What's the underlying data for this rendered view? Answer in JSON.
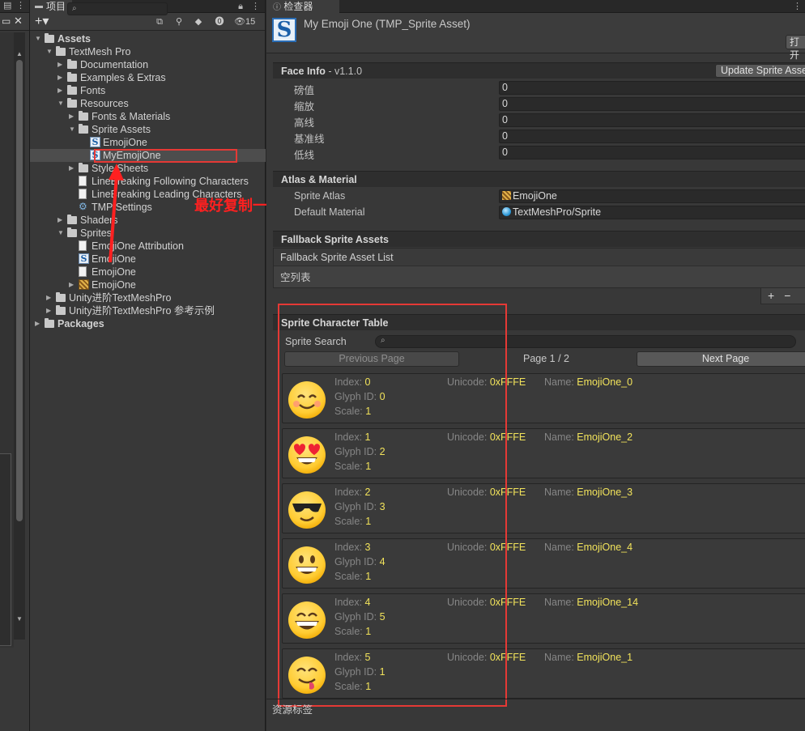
{
  "project_panel": {
    "tab_label": "项目",
    "search_placeholder": "",
    "visible_count": "15",
    "tree": [
      {
        "label": "Assets",
        "depth": 0,
        "kind": "folder",
        "expanded": true,
        "bold": true
      },
      {
        "label": "TextMesh Pro",
        "depth": 1,
        "kind": "folder",
        "expanded": true
      },
      {
        "label": "Documentation",
        "depth": 2,
        "kind": "folder",
        "expanded": false
      },
      {
        "label": "Examples & Extras",
        "depth": 2,
        "kind": "folder",
        "expanded": false
      },
      {
        "label": "Fonts",
        "depth": 2,
        "kind": "folder",
        "expanded": false
      },
      {
        "label": "Resources",
        "depth": 2,
        "kind": "folder",
        "expanded": true
      },
      {
        "label": "Fonts & Materials",
        "depth": 3,
        "kind": "folder",
        "expanded": false
      },
      {
        "label": "Sprite Assets",
        "depth": 3,
        "kind": "folder",
        "expanded": true
      },
      {
        "label": "EmojiOne",
        "depth": 4,
        "kind": "sprite-asset"
      },
      {
        "label": "MyEmojiOne",
        "depth": 4,
        "kind": "sprite-asset",
        "selected": true
      },
      {
        "label": "Style Sheets",
        "depth": 3,
        "kind": "folder",
        "expanded": false
      },
      {
        "label": "LineBreaking Following Characters",
        "depth": 3,
        "kind": "text"
      },
      {
        "label": "LineBreaking Leading Characters",
        "depth": 3,
        "kind": "text"
      },
      {
        "label": "TMP Settings",
        "depth": 3,
        "kind": "settings"
      },
      {
        "label": "Shaders",
        "depth": 2,
        "kind": "folder",
        "expanded": false
      },
      {
        "label": "Sprites",
        "depth": 2,
        "kind": "folder",
        "expanded": true
      },
      {
        "label": "EmojiOne Attribution",
        "depth": 3,
        "kind": "text"
      },
      {
        "label": "EmojiOne",
        "depth": 3,
        "kind": "sprite-asset"
      },
      {
        "label": "EmojiOne",
        "depth": 3,
        "kind": "text"
      },
      {
        "label": "EmojiOne",
        "depth": 3,
        "kind": "atlas",
        "expandable": true
      },
      {
        "label": "Unity进阶TextMeshPro",
        "depth": 1,
        "kind": "folder",
        "expanded": false
      },
      {
        "label": "Unity进阶TextMeshPro 参考示例",
        "depth": 1,
        "kind": "folder",
        "expanded": false
      },
      {
        "label": "Packages",
        "depth": 0,
        "kind": "folder",
        "expanded": false,
        "bold": true
      }
    ]
  },
  "annotation": {
    "text": "最好复制一份到Resource并改名",
    "color": "#ff2020"
  },
  "inspector": {
    "tab_label": "检查器",
    "asset_title": "My Emoji One (TMP_Sprite Asset)",
    "open_button": "打开",
    "face_info": {
      "title": "Face Info",
      "version": " - v1.1.0",
      "update_button": "Update Sprite Asset",
      "fields": [
        {
          "label": "磅值",
          "value": "0"
        },
        {
          "label": "缩放",
          "value": "0"
        },
        {
          "label": "高线",
          "value": "0"
        },
        {
          "label": "基准线",
          "value": "0"
        },
        {
          "label": "低线",
          "value": "0"
        }
      ]
    },
    "atlas_material": {
      "title": "Atlas & Material",
      "sprite_atlas_label": "Sprite Atlas",
      "sprite_atlas_value": "EmojiOne",
      "default_material_label": "Default Material",
      "default_material_value": "TextMeshPro/Sprite"
    },
    "fallback": {
      "title": "Fallback Sprite Assets",
      "list_header": "Fallback Sprite Asset List",
      "empty_text": "空列表",
      "add": "+",
      "remove": "−"
    },
    "sprite_table": {
      "title": "Sprite Character Table",
      "search_label": "Sprite Search",
      "prev_button": "Previous Page",
      "page_label": "Page 1 / 2",
      "next_button": "Next Page",
      "labels": {
        "index": "Index: ",
        "unicode": "Unicode: ",
        "name": "Name: ",
        "glyph": "Glyph ID: ",
        "scale": "Scale: "
      },
      "rows": [
        {
          "index": "0",
          "unicode": "0xFFFE",
          "name": "EmojiOne_0",
          "glyph_id": "0",
          "scale": "1",
          "emoji": "smile-blush"
        },
        {
          "index": "1",
          "unicode": "0xFFFE",
          "name": "EmojiOne_2",
          "glyph_id": "2",
          "scale": "1",
          "emoji": "heart-eyes"
        },
        {
          "index": "2",
          "unicode": "0xFFFE",
          "name": "EmojiOne_3",
          "glyph_id": "3",
          "scale": "1",
          "emoji": "sunglasses"
        },
        {
          "index": "3",
          "unicode": "0xFFFE",
          "name": "EmojiOne_4",
          "glyph_id": "4",
          "scale": "1",
          "emoji": "grin"
        },
        {
          "index": "4",
          "unicode": "0xFFFE",
          "name": "EmojiOne_14",
          "glyph_id": "5",
          "scale": "1",
          "emoji": "big-grin"
        },
        {
          "index": "5",
          "unicode": "0xFFFE",
          "name": "EmojiOne_1",
          "glyph_id": "1",
          "scale": "1",
          "emoji": "yum"
        }
      ]
    },
    "footer_label": "资源标签"
  },
  "colors": {
    "value_yellow": "#f2e35b",
    "highlight_red": "#e53935",
    "panel_bg": "#383838"
  }
}
